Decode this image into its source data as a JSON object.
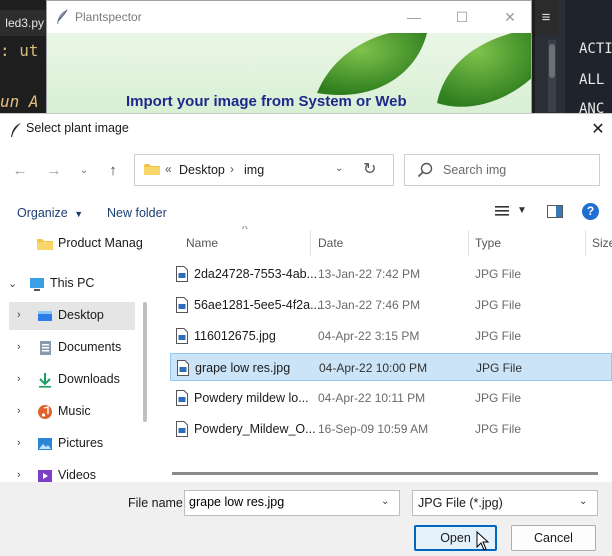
{
  "editor_left": {
    "tab_label": "led3.py",
    "code_line_1": ": ut",
    "code_line_2": "un A"
  },
  "editor_right": {
    "menu_icon": "hamburger-icon",
    "words": [
      "ACTI",
      "ALL",
      "ANC"
    ]
  },
  "plantspector": {
    "title": "Plantspector",
    "heading": "Import your image from System or Web",
    "window_buttons": [
      "minimize",
      "maximize",
      "close"
    ]
  },
  "dialog": {
    "title": "Select plant image",
    "breadcrumb": {
      "overflow": "«",
      "segments": [
        "Desktop",
        "img"
      ],
      "separator": "›"
    },
    "search_placeholder": "Search img",
    "toolbar": {
      "organize_label": "Organize",
      "new_folder_label": "New folder"
    },
    "nav_tree": [
      {
        "label": "Product Manag",
        "icon": "folder-icon",
        "expandable": false
      },
      {
        "label": "This PC",
        "icon": "pc-icon",
        "expandable": true,
        "expanded": true
      },
      {
        "label": "Desktop",
        "icon": "desktop-icon",
        "expandable": true,
        "selected": true
      },
      {
        "label": "Documents",
        "icon": "documents-icon",
        "expandable": true
      },
      {
        "label": "Downloads",
        "icon": "downloads-icon",
        "expandable": true
      },
      {
        "label": "Music",
        "icon": "music-icon",
        "expandable": true
      },
      {
        "label": "Pictures",
        "icon": "pictures-icon",
        "expandable": true
      },
      {
        "label": "Videos",
        "icon": "videos-icon",
        "expandable": true
      }
    ],
    "columns": [
      "Name",
      "Date",
      "Type",
      "Size"
    ],
    "files": [
      {
        "name": "2da24728-7553-4ab...",
        "date": "13-Jan-22 7:42 PM",
        "type": "JPG File",
        "selected": false
      },
      {
        "name": "56ae1281-5ee5-4f2a...",
        "date": "13-Jan-22 7:46 PM",
        "type": "JPG File",
        "selected": false
      },
      {
        "name": "116012675.jpg",
        "date": "04-Apr-22 3:15 PM",
        "type": "JPG File",
        "selected": false
      },
      {
        "name": "grape low res.jpg",
        "date": "04-Apr-22 10:00 PM",
        "type": "JPG File",
        "selected": true
      },
      {
        "name": "Powdery mildew lo...",
        "date": "04-Apr-22 10:11 PM",
        "type": "JPG File",
        "selected": false
      },
      {
        "name": "Powdery_Mildew_O...",
        "date": "16-Sep-09 10:59 AM",
        "type": "JPG File",
        "selected": false
      }
    ],
    "file_name_label": "File name:",
    "file_name_value": "grape low res.jpg",
    "file_type_value": "JPG File (*.jpg)",
    "open_label": "Open",
    "cancel_label": "Cancel"
  },
  "colors": {
    "selection": "#cce4f7",
    "accent": "#0067c0",
    "heading": "#1d2a8c",
    "link": "#1a3e72"
  }
}
